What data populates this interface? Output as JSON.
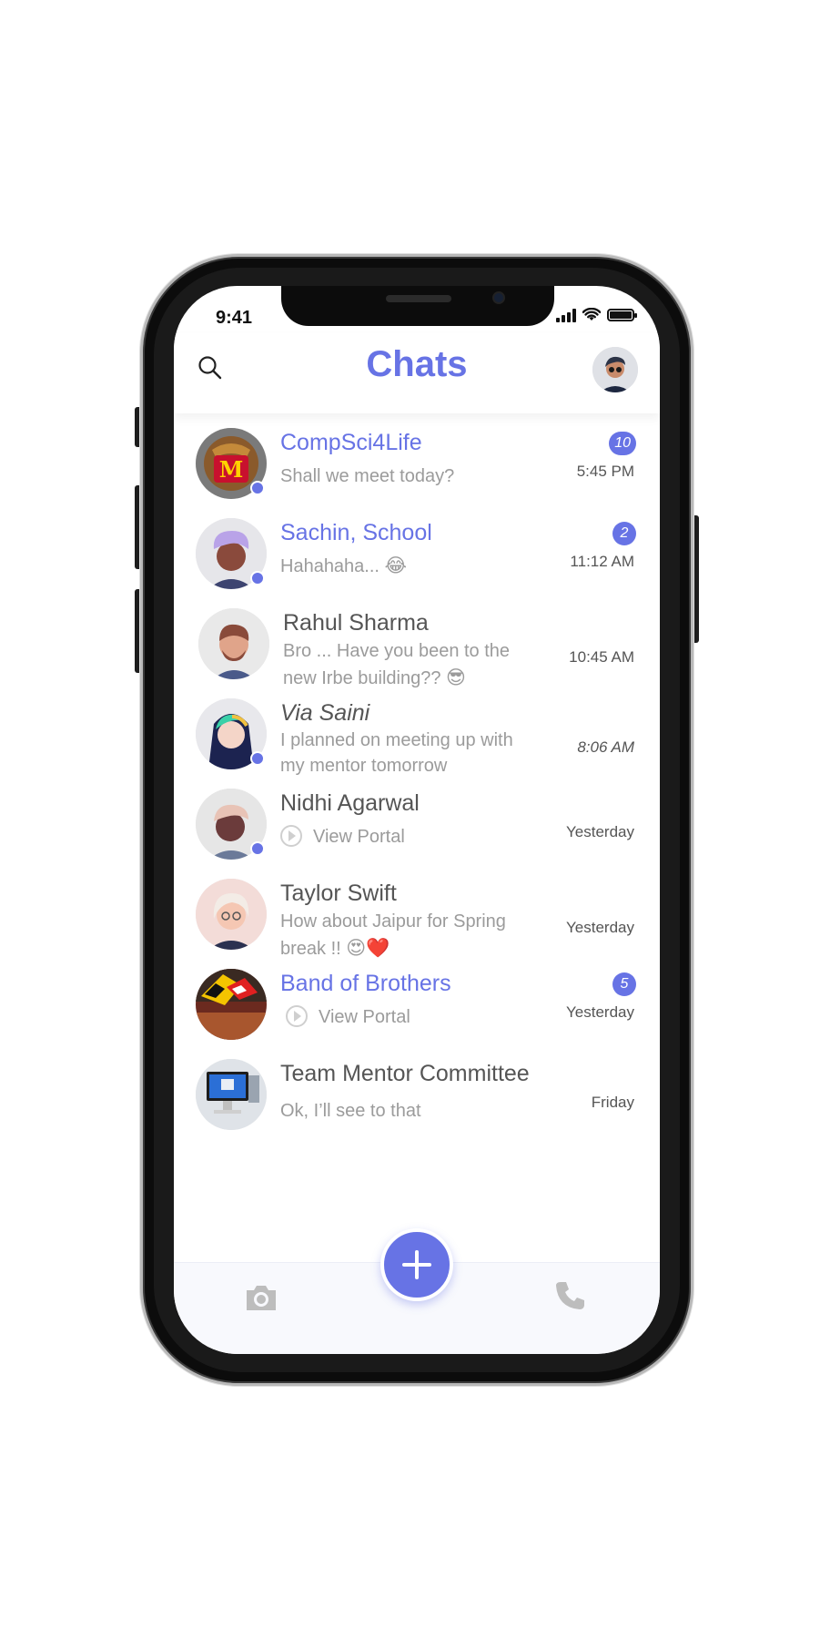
{
  "status_bar": {
    "time": "9:41"
  },
  "header": {
    "title": "Chats",
    "search_icon": "search-icon",
    "profile_icon": "avatar"
  },
  "colors": {
    "accent": "#6773e5",
    "text_dark": "#555555",
    "text_muted": "#9b9b9b",
    "online": "#6773e5"
  },
  "chats": [
    {
      "name": "CompSci4Life",
      "preview": "Shall we meet today?",
      "time": "5:45 PM",
      "unread": "10",
      "online": true,
      "highlight": true
    },
    {
      "name": "Sachin, School",
      "preview": "Hahahaha...",
      "emoji": "😂",
      "time": "11:12 AM",
      "unread": "2",
      "online": true,
      "highlight": true
    },
    {
      "name": "Rahul Sharma",
      "preview": "Bro ... Have you been to the new Irbe building??",
      "emoji": "😎",
      "time": "10:45 AM",
      "online": false
    },
    {
      "name": "Via Saini",
      "preview": "I planned on meeting up with my mentor tomorrow",
      "time": "8:06 AM",
      "online": true
    },
    {
      "name": "Nidhi Agarwal",
      "preview": "View Portal",
      "time": "Yesterday",
      "online": true
    },
    {
      "name": "Taylor Swift",
      "preview": "How about Jaipur for Spring break !!",
      "emoji": "😍❤️",
      "time": "Yesterday",
      "online": false
    },
    {
      "name": "Band of Brothers",
      "preview": "View Portal",
      "time": "Yesterday",
      "unread": "5",
      "online": false,
      "highlight": true
    },
    {
      "name": "Team Mentor Committee",
      "preview": "Ok, I’ll see to that",
      "time": "Friday",
      "online": false
    }
  ],
  "bottom_bar": {
    "camera_icon": "camera-icon",
    "compose_icon": "plus-icon",
    "phone_icon": "phone-icon"
  }
}
